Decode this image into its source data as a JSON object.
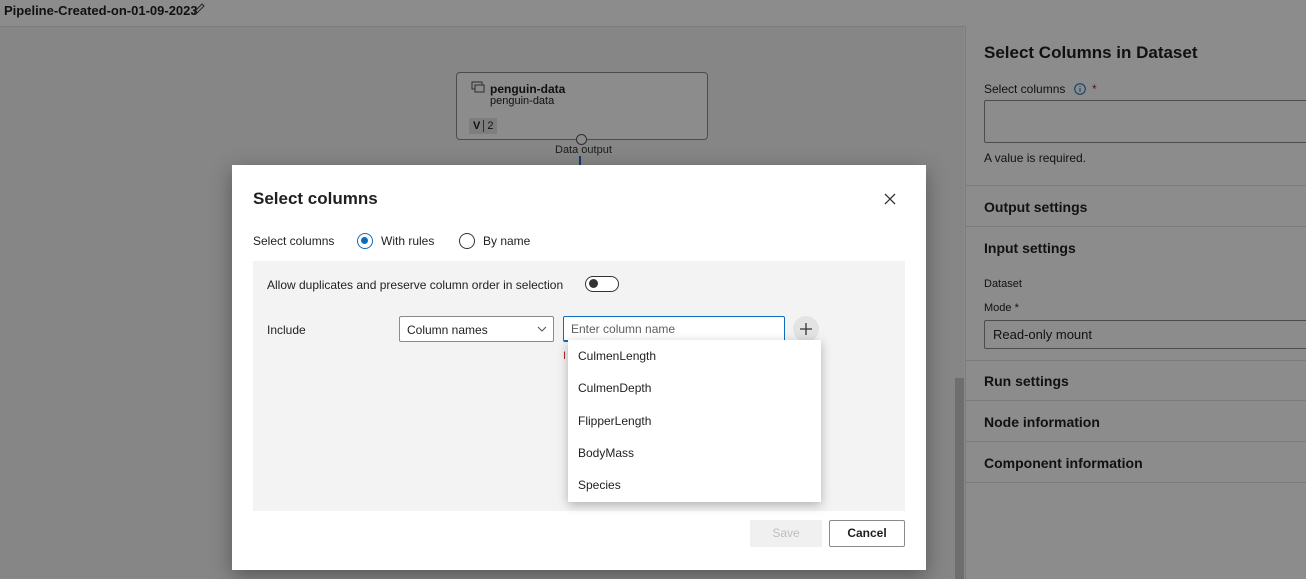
{
  "app": {
    "pipeline_title": "Pipeline-Created-on-01-09-2023",
    "node": {
      "title": "penguin-data",
      "subtitle": "penguin-data",
      "version_prefix": "V",
      "version": "2",
      "output_label": "Data output"
    }
  },
  "panel": {
    "title": "Select Columns in Dataset",
    "select_columns_label": "Select columns",
    "required_marker": "*",
    "error_text": "A value is required.",
    "sections": [
      "Output settings",
      "Input settings",
      "Run settings",
      "Node information",
      "Component information"
    ],
    "dataset_label": "Dataset",
    "mode_label": "Mode *",
    "mode_value": "Read-only mount"
  },
  "dialog": {
    "title": "Select columns",
    "radio_group_label": "Select columns",
    "radio_options": [
      "With rules",
      "By name"
    ],
    "selected_radio": "With rules",
    "allow_duplicates_label": "Allow duplicates and preserve column order in selection",
    "allow_duplicates_on": false,
    "include_label": "Include",
    "column_type_value": "Column names",
    "column_input_placeholder": "Enter column name",
    "error_glyph": "I",
    "dropdown_items": [
      "CulmenLength",
      "CulmenDepth",
      "FlipperLength",
      "BodyMass",
      "Species"
    ],
    "save_label": "Save",
    "cancel_label": "Cancel"
  },
  "colors": {
    "accent": "#0f6cbd",
    "error": "#a4262c",
    "connector": "#2b6cd1"
  },
  "icons": {
    "edit": "pencil-icon",
    "node": "dataset-icon",
    "info": "info-icon",
    "close": "close-icon",
    "chevron": "chevron-down-icon",
    "add": "plus-icon"
  }
}
